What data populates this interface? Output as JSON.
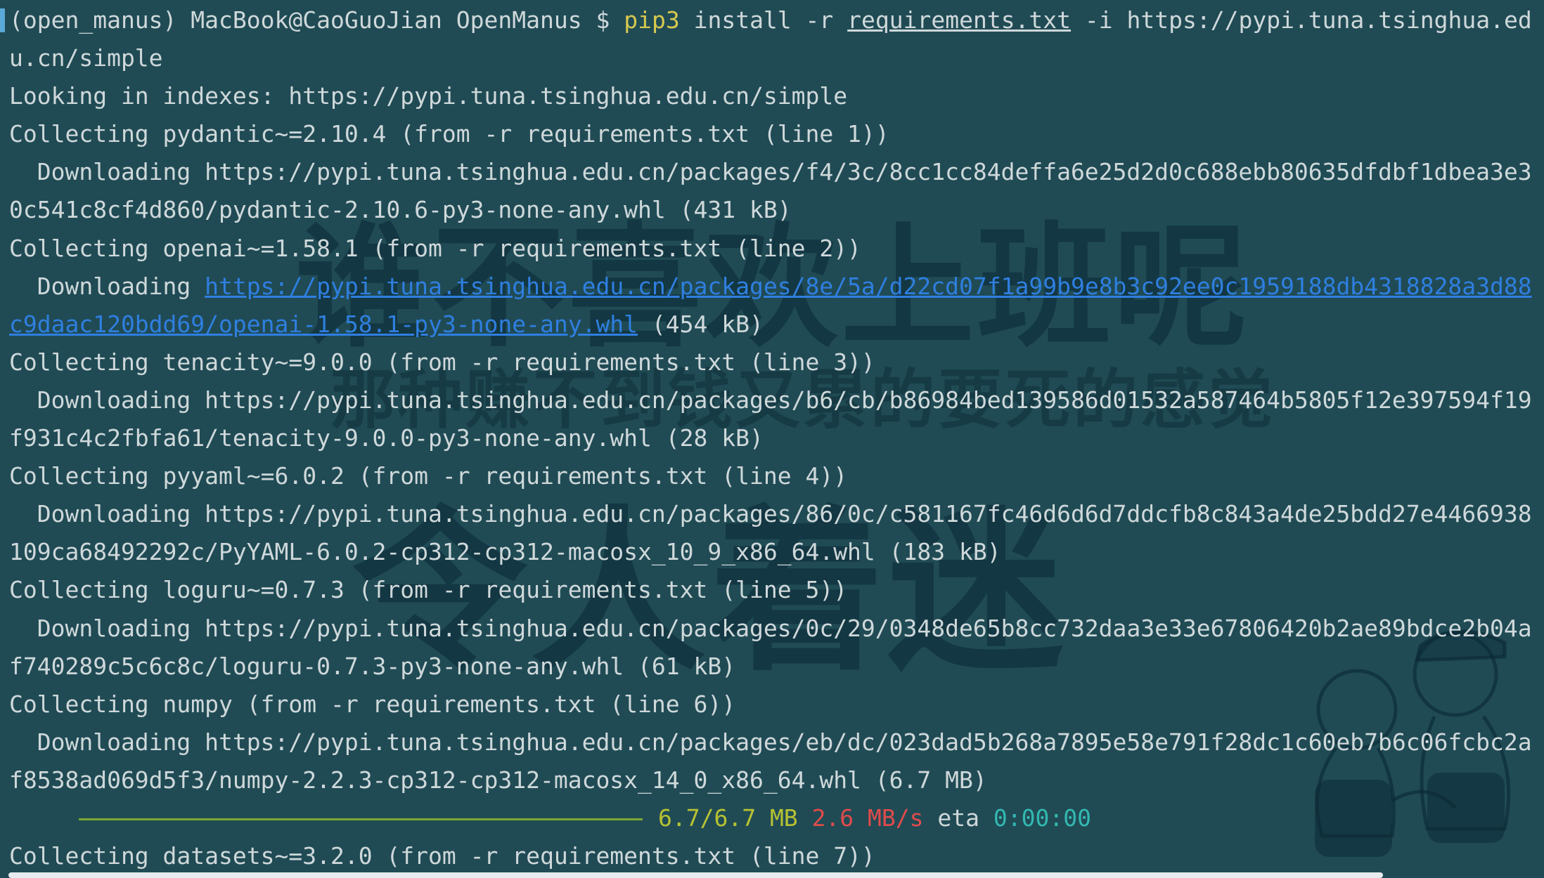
{
  "prompt": {
    "env": "(open_manus)",
    "host": "MacBook@CaoGuoJian",
    "dir": "OpenManus",
    "symbol": "$",
    "command": "pip3",
    "args_pre": "install -r",
    "file": "requirements.txt",
    "args_post": "-i https://pypi.tuna.tsinghua.ed",
    "wrap": "u.cn/simple"
  },
  "output": {
    "l3": "Looking in indexes: https://pypi.tuna.tsinghua.edu.cn/simple",
    "l4": "Collecting pydantic~=2.10.4 (from -r requirements.txt (line 1))",
    "l5": "  Downloading https://pypi.tuna.tsinghua.edu.cn/packages/f4/3c/8cc1cc84deffa6e25d2d0c688ebb80635dfdbf1dbea3e3",
    "l6": "0c541c8cf4d860/pydantic-2.10.6-py3-none-any.whl (431 kB)",
    "l7": "Collecting openai~=1.58.1 (from -r requirements.txt (line 2))",
    "l8_pre": "  Downloading ",
    "l8_link": "https://pypi.tuna.tsinghua.edu.cn/packages/8e/5a/d22cd07f1a99b9e8b3c92ee0c1959188db4318828a3d88",
    "l9_link": "c9daac120bdd69/openai-1.58.1-py3-none-any.whl",
    "l9_post": " (454 kB)",
    "l10": "Collecting tenacity~=9.0.0 (from -r requirements.txt (line 3))",
    "l11": "  Downloading https://pypi.tuna.tsinghua.edu.cn/packages/b6/cb/b86984bed139586d01532a587464b5805f12e397594f19",
    "l12": "f931c4c2fbfa61/tenacity-9.0.0-py3-none-any.whl (28 kB)",
    "l13": "Collecting pyyaml~=6.0.2 (from -r requirements.txt (line 4))",
    "l14": "  Downloading https://pypi.tuna.tsinghua.edu.cn/packages/86/0c/c581167fc46d6d6d7ddcfb8c843a4de25bdd27e4466938",
    "l15": "109ca68492292c/PyYAML-6.0.2-cp312-cp312-macosx_10_9_x86_64.whl (183 kB)",
    "l16": "Collecting loguru~=0.7.3 (from -r requirements.txt (line 5))",
    "l17": "  Downloading https://pypi.tuna.tsinghua.edu.cn/packages/0c/29/0348de65b8cc732daa3e33e67806420b2ae89bdce2b04a",
    "l18": "f740289c5c6c8c/loguru-0.7.3-py3-none-any.whl (61 kB)",
    "l19": "Collecting numpy (from -r requirements.txt (line 6))",
    "l20": "  Downloading https://pypi.tuna.tsinghua.edu.cn/packages/eb/dc/023dad5b268a7895e58e791f28dc1c60eb7b6c06fcbc2a",
    "l21": "f8538ad069d5f3/numpy-2.2.3-cp312-cp312-macosx_14_0_x86_64.whl (6.7 MB)",
    "progress": {
      "fraction": 1.0,
      "size": "6.7/6.7 MB",
      "speed": "2.6 MB/s",
      "eta_label": "eta",
      "eta": "0:00:00"
    },
    "l23": "Collecting datasets~=3.2.0 (from -r requirements.txt (line 7))"
  },
  "watermark": {
    "line1": "谁不喜欢上班呢",
    "line2": "那种赚不到钱又累的要死的感觉",
    "line3": "令人着迷"
  },
  "colors": {
    "background": "#204b55",
    "text": "#cfd8da",
    "command": "#d7c84e",
    "link": "#2f7fe0",
    "progress_bar": "#7ba832",
    "size": "#b7c232",
    "speed": "#e04b4b",
    "time": "#33b8b0"
  }
}
